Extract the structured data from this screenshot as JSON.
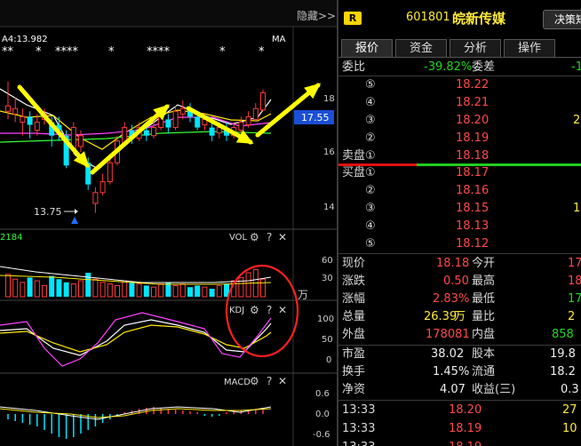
{
  "toolbar": {
    "hide_label": "隐藏>>",
    "r_badge": "R",
    "code": "601801",
    "name": "皖新传媒",
    "decision_btn": "决策矩"
  },
  "tabs": [
    {
      "label": "报价"
    },
    {
      "label": "资金"
    },
    {
      "label": "分析"
    },
    {
      "label": "操作"
    }
  ],
  "order_book": {
    "wei_bi_label": "委比",
    "wei_bi_value": "-39.82%",
    "wei_cha_label": "委差",
    "wei_cha_value": "-1",
    "sell_label": "卖盘",
    "buy_label": "买盘",
    "sell": [
      {
        "idx": "⑤",
        "price": "18.22",
        "vol": ""
      },
      {
        "idx": "④",
        "price": "18.21",
        "vol": ""
      },
      {
        "idx": "③",
        "price": "18.20",
        "vol": "2"
      },
      {
        "idx": "②",
        "price": "18.19",
        "vol": ""
      },
      {
        "idx": "①",
        "price": "18.18",
        "vol": ""
      }
    ],
    "buy": [
      {
        "idx": "①",
        "price": "18.17",
        "vol": ""
      },
      {
        "idx": "②",
        "price": "18.16",
        "vol": ""
      },
      {
        "idx": "③",
        "price": "18.15",
        "vol": "1"
      },
      {
        "idx": "④",
        "price": "18.13",
        "vol": ""
      },
      {
        "idx": "⑤",
        "price": "18.12",
        "vol": ""
      }
    ]
  },
  "quote": {
    "xian_jia_label": "现价",
    "xian_jia": "18.18",
    "jin_kai_label": "今开",
    "jin_kai": "17",
    "zhang_die_label": "涨跌",
    "zhang_die": "0.50",
    "zui_gao_label": "最高",
    "zui_gao": "18",
    "zhang_fu_label": "涨幅",
    "zhang_fu": "2.83%",
    "zui_di_label": "最低",
    "zui_di": "17",
    "zong_liang_label": "总量",
    "zong_liang": "26.39",
    "zong_liang_unit": "万",
    "liang_bi_label": "量比",
    "liang_bi": "2",
    "wai_pan_label": "外盘",
    "wai_pan": "178081",
    "nei_pan_label": "内盘",
    "nei_pan": "858"
  },
  "fund": {
    "shi_ying_label": "市盈",
    "shi_ying": "38.02",
    "gu_ben_label": "股本",
    "gu_ben": "19.8",
    "huan_shou_label": "换手",
    "huan_shou": "1.45%",
    "liu_tong_label": "流通",
    "liu_tong": "18.2",
    "jing_zi_label": "净资",
    "jing_zi": "4.07",
    "shou_yi_label": "收益(三)",
    "shou_yi": "0.3"
  },
  "ticks": [
    {
      "time": "13:33",
      "price": "18.20",
      "vol": "27"
    },
    {
      "time": "13:33",
      "price": "18.19",
      "vol": "10"
    },
    {
      "time": "13:33",
      "price": "18.19",
      "vol": ""
    }
  ],
  "main_chart": {
    "ma_label": "A4:13.982",
    "ma_tag": "MA",
    "low_marker": "13.75",
    "price_tag": "17.55",
    "stars": [
      "**",
      "*",
      "****",
      "*",
      "****",
      "*",
      "*"
    ]
  },
  "y_axis": {
    "price_ticks": [
      "18",
      "16",
      "14"
    ],
    "vol_ticks": [
      "60",
      "30"
    ],
    "vol_unit": "万",
    "kdj_ticks": [
      "100",
      "50",
      "0"
    ],
    "macd_ticks": [
      "0.6",
      "0.0",
      "-0.6"
    ]
  },
  "panels": {
    "vol": {
      "label": "VOL",
      "value": "2184"
    },
    "kdj": {
      "label": "KDJ"
    },
    "macd": {
      "label": "MACD"
    }
  },
  "icons": {
    "gear": "gear-icon",
    "help": "help-icon",
    "close": "close-icon"
  },
  "colors": {
    "up": "#ff3b3b",
    "down": "#00e5ff",
    "ma5": "#ffffff",
    "ma10": "#ffea00",
    "ma20": "#ff44ff",
    "ma60": "#33ff33",
    "arrow": "#ffff00",
    "circle": "#ff2020"
  }
}
